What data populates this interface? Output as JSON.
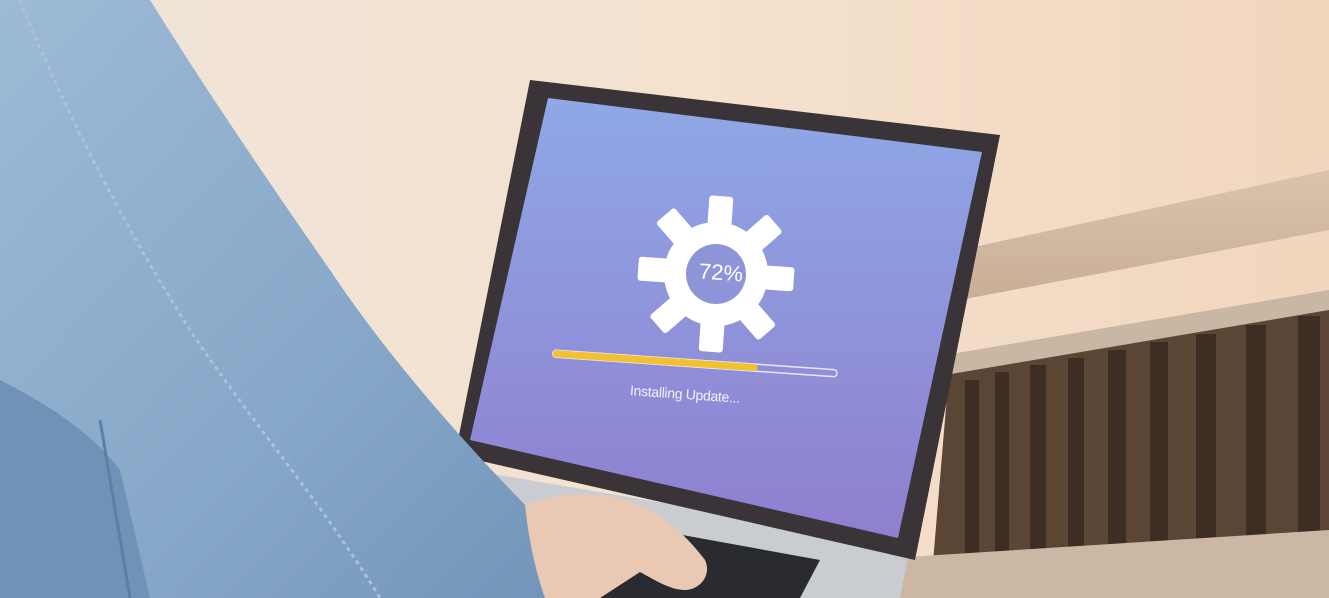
{
  "screen": {
    "percent_label": "72%",
    "status_text": "Installing Update...",
    "progress": 0.72
  },
  "colors": {
    "screen_top": "#8fa8e6",
    "screen_bottom": "#8f7fcf",
    "progress_fill": "#f2c12e",
    "gear": "#ffffff",
    "jacket": "#8fb0cf",
    "background": "#f2ddc8"
  },
  "icons": [
    "gear-icon"
  ]
}
